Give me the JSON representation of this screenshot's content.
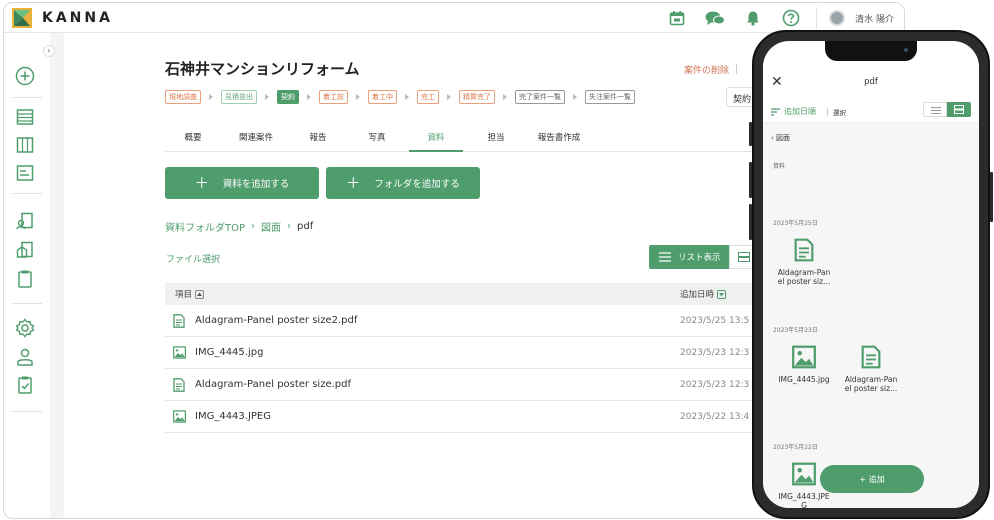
{
  "app": {
    "name": "KANNA"
  },
  "topbar": {
    "user_name": "清水 陽介"
  },
  "project": {
    "title": "石神井マンションリフォーム",
    "delete_link": "案件の削除",
    "contract_button": "契約",
    "statuses": [
      "現地調査",
      "見積提出",
      "契約",
      "着工前",
      "着工中",
      "完工",
      "精算完了",
      "完了案件一覧",
      "失注案件一覧"
    ]
  },
  "tabs": [
    "概要",
    "関連案件",
    "報告",
    "写真",
    "資料",
    "担当",
    "報告書作成"
  ],
  "actions": {
    "add_document": "資料を追加する",
    "add_folder": "フォルダを追加する"
  },
  "breadcrumb": {
    "root": "資料フォルダTOP",
    "folder": "図面",
    "current": "pdf"
  },
  "file_select": "ファイル選択",
  "view_toggle": {
    "list_label": "リスト表示"
  },
  "table": {
    "col_name": "項目",
    "col_date": "追加日時",
    "rows": [
      {
        "name": "Aldagram-Panel poster size2.pdf",
        "date": "2023/5/25 13:5",
        "type": "doc"
      },
      {
        "name": "IMG_4445.jpg",
        "date": "2023/5/23 12:3",
        "type": "image"
      },
      {
        "name": "Aldagram-Panel poster size.pdf",
        "date": "2023/5/23 12:3",
        "type": "doc"
      },
      {
        "name": "IMG_4443.JPEG",
        "date": "2023/5/22 13:4",
        "type": "image"
      }
    ]
  },
  "mobile": {
    "title": "pdf",
    "sort_label": "追加日順",
    "select_label": "選択",
    "back_label": "図面",
    "section_label": "資料",
    "groups": [
      {
        "date": "2023年5月25日",
        "tiles": [
          {
            "label": "Aldagram-Panel poster siz...",
            "type": "doc"
          }
        ]
      },
      {
        "date": "2023年5月23日",
        "tiles": [
          {
            "label": "IMG_4445.jpg",
            "type": "image"
          },
          {
            "label": "Aldagram-Panel poster siz...",
            "type": "doc"
          }
        ]
      },
      {
        "date": "2023年5月22日",
        "tiles": [
          {
            "label": "IMG_4443.JPEG",
            "type": "image"
          }
        ]
      }
    ],
    "add_button": "+ 追加"
  },
  "colors": {
    "accent": "#4f9d6c",
    "status_orange": "#e07a4b",
    "delete": "#d2735a"
  }
}
